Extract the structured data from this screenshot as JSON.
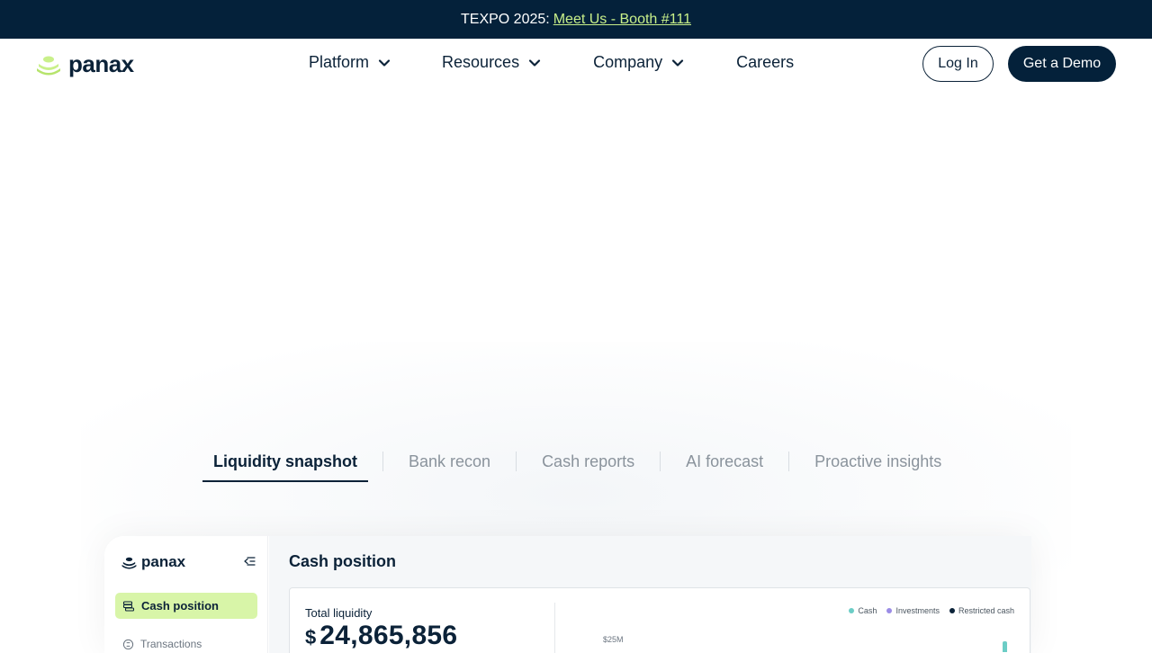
{
  "banner": {
    "prefix": "TEXPO 2025:",
    "link": "Meet Us - Booth #111"
  },
  "brand": {
    "name": "panax",
    "accent": "#c9f08a",
    "dark": "#04213a"
  },
  "nav": {
    "items": [
      {
        "label": "Platform",
        "has_dropdown": true
      },
      {
        "label": "Resources",
        "has_dropdown": true
      },
      {
        "label": "Company",
        "has_dropdown": true
      },
      {
        "label": "Careers",
        "has_dropdown": false
      }
    ],
    "login": "Log In",
    "demo": "Get a Demo"
  },
  "tabs": {
    "items": [
      {
        "label": "Liquidity snapshot",
        "active": true
      },
      {
        "label": "Bank recon",
        "active": false
      },
      {
        "label": "Cash reports",
        "active": false
      },
      {
        "label": "AI forecast",
        "active": false
      },
      {
        "label": "Proactive insights",
        "active": false
      }
    ]
  },
  "app": {
    "logo": "panax",
    "sidebar": {
      "active_item": "Cash position",
      "next_item": "Transactions"
    },
    "main": {
      "title": "Cash position",
      "total_liquidity_label": "Total liquidity",
      "currency_symbol": "$",
      "total_liquidity_value": "24,865,856",
      "y_tick": "$25M",
      "legend": [
        {
          "label": "Cash",
          "color": "#6ccdc6"
        },
        {
          "label": "Investments",
          "color": "#9b8ce6"
        },
        {
          "label": "Restricted cash",
          "color": "#0b2238"
        }
      ]
    }
  }
}
